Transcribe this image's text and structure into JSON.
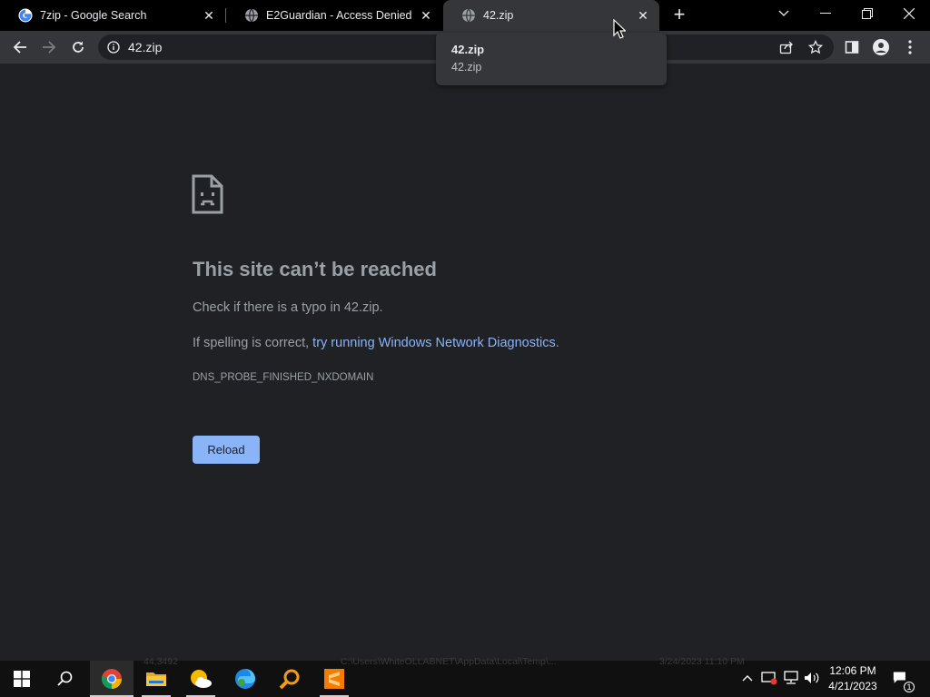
{
  "browser": {
    "tabs": [
      {
        "title": "7zip - Google Search",
        "icon": "google-icon"
      },
      {
        "title": "E2Guardian - Access Denied",
        "icon": "globe-icon"
      },
      {
        "title": "42.zip",
        "icon": "globe-icon",
        "active": true
      }
    ],
    "address_bar": {
      "url": "42.zip"
    },
    "hover_card": {
      "title": "42.zip",
      "url": "42.zip"
    }
  },
  "error_page": {
    "heading": "This site can’t be reached",
    "line1": "Check if there is a typo in 42.zip.",
    "line2_prefix": "If spelling is correct, ",
    "line2_link": "try running Windows Network Diagnostics",
    "line2_suffix": ".",
    "error_code": "DNS_PROBE_FINISHED_NXDOMAIN",
    "reload_label": "Reload"
  },
  "taskbar": {
    "apps": [
      "start-icon",
      "search-icon",
      "chrome-icon",
      "file-explorer-icon",
      "weather-icon",
      "edge-icon",
      "search-app-icon",
      "sublime-icon"
    ],
    "ghost_texts": [
      "44,3492",
      "C:\\Users\\WhiteOLLABNET\\AppData\\Local\\Temp\\...",
      "3/24/2023 11:10 PM"
    ],
    "clock_time": "12:06 PM",
    "clock_date": "4/21/2023",
    "notification_count": "1"
  },
  "colors": {
    "page_bg": "#202124",
    "toolbar_bg": "#35363a",
    "accent": "#8ab4f8",
    "text_muted": "#9aa0a6"
  }
}
